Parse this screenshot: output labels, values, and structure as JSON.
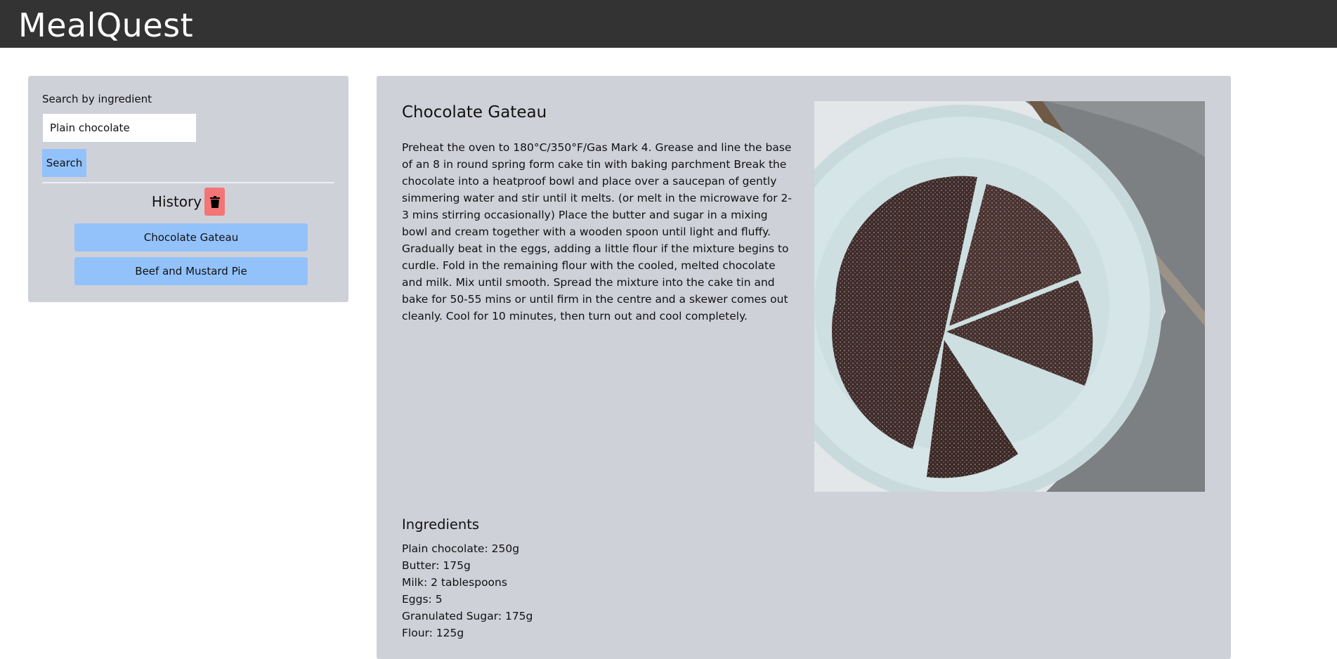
{
  "app": {
    "brand": "MealQuest"
  },
  "search": {
    "label": "Search by ingredient",
    "value": "Plain chocolate",
    "button_label": "Search"
  },
  "history": {
    "title": "History",
    "clear_icon": "trash-icon",
    "items": [
      {
        "label": "Chocolate Gateau"
      },
      {
        "label": "Beef and Mustard Pie"
      }
    ]
  },
  "recipe": {
    "title": "Chocolate Gateau",
    "instructions": "Preheat the oven to 180°C/350°F/Gas Mark 4. Grease and line the base of an 8 in round spring form cake tin with baking parchment Break the chocolate into a heatproof bowl and place over a saucepan of gently simmering water and stir until it melts. (or melt in the microwave for 2-3 mins stirring occasionally) Place the butter and sugar in a mixing bowl and cream together with a wooden spoon until light and fluffy. Gradually beat in the eggs, adding a little flour if the mixture begins to curdle. Fold in the remaining flour with the cooled, melted chocolate and milk. Mix until smooth. Spread the mixture into the cake tin and bake for 50-55 mins or until firm in the centre and a skewer comes out cleanly. Cool for 10 minutes, then turn out and cool completely.",
    "ingredients_title": "Ingredients",
    "ingredients": [
      "Plain chocolate: 250g",
      "Butter: 175g",
      "Milk: 2 tablespoons",
      "Eggs: 5",
      "Granulated Sugar: 175g",
      "Flour: 125g"
    ]
  },
  "colors": {
    "navbar": "#333333",
    "panel": "#cfd1d9",
    "button_blue": "#93c2fb",
    "delete_red": "#f37575"
  }
}
